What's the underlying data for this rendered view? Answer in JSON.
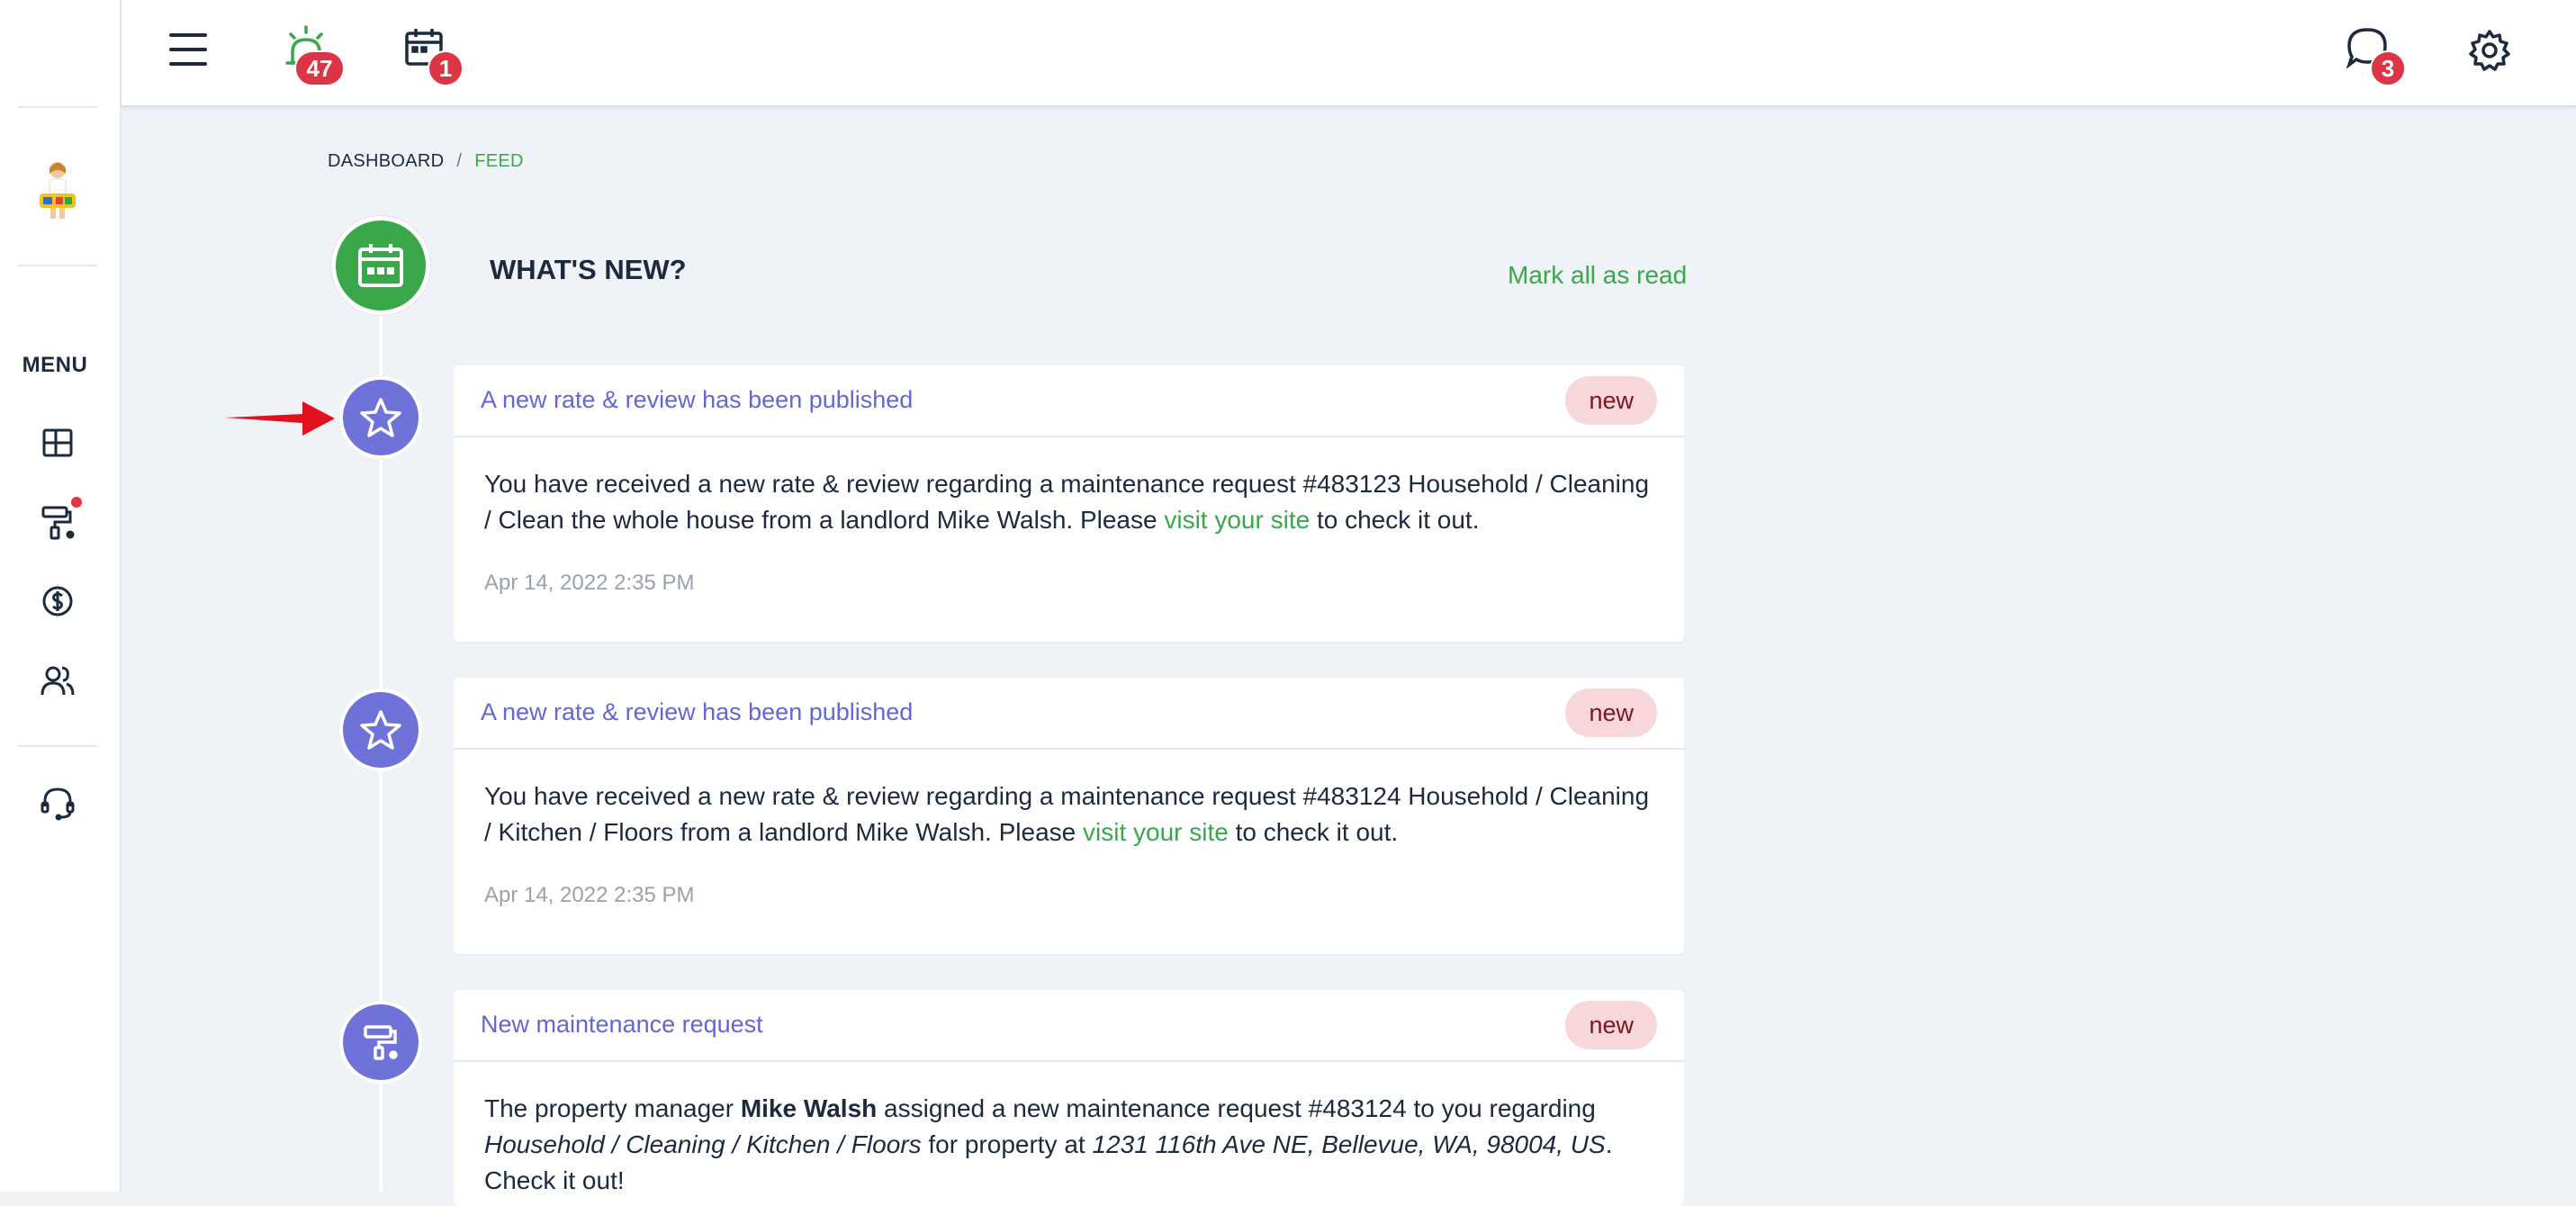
{
  "header": {
    "alerts_badge": "47",
    "calendar_badge": "1",
    "messages_badge": "3"
  },
  "sidebar": {
    "menu_label": "MENU"
  },
  "breadcrumb": {
    "home": "DASHBOARD",
    "separator": "/",
    "current": "FEED"
  },
  "feed": {
    "title": "WHAT'S NEW?",
    "mark_all_label": "Mark all as read",
    "items": [
      {
        "title": "A new rate & review has been published",
        "badge": "new",
        "text_before_link": "You have received a new rate & review regarding a maintenance request #483123 Household / Cleaning / Clean the whole house from a landlord Mike Walsh. Please ",
        "link_text": "visit your site",
        "text_after_link": " to check it out.",
        "date": "Apr 14, 2022 2:35 PM"
      },
      {
        "title": "A new rate & review has been published",
        "badge": "new",
        "text_before_link": "You have received a new rate & review regarding a maintenance request #483124 Household / Cleaning / Kitchen / Floors from a landlord Mike Walsh. Please ",
        "link_text": "visit your site",
        "text_after_link": " to check it out.",
        "date": "Apr 14, 2022 2:35 PM"
      },
      {
        "title": "New maintenance request",
        "badge": "new",
        "text_1": "The property manager ",
        "manager_name": "Mike Walsh",
        "text_2": " assigned a new maintenance request #483124 to you regarding ",
        "category": "Household / Cleaning / Kitchen / Floors",
        "text_3": " for property at ",
        "address": "1231 116th Ave NE, Bellevue, WA, 98004, US",
        "text_4": ". Check it out!"
      }
    ]
  },
  "colors": {
    "accent_green": "#3aa84a",
    "timeline_purple": "#6f73d9",
    "badge_red": "#dc3545",
    "pill_bg": "#f8d7da"
  }
}
